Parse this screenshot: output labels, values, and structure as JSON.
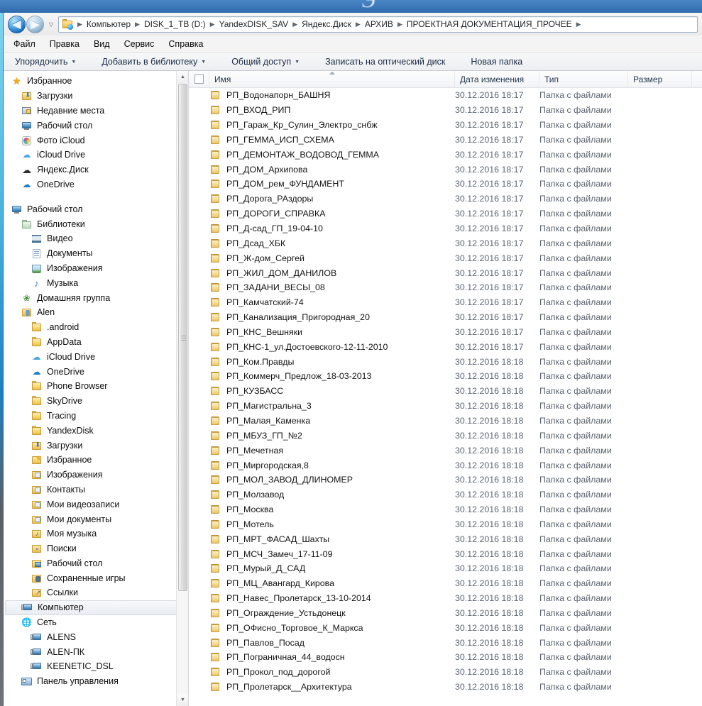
{
  "window": {
    "title_glyph": "Э"
  },
  "nav": {
    "back_label": "◀",
    "forward_label": "▶",
    "history_caret": "▽",
    "breadcrumbs": [
      "Компьютер",
      "DISK_1_TB (D:)",
      "YandexDISK_SAV",
      "Яндекс.Диск",
      "АРХИВ",
      "ПРОЕКТНАЯ ДОКУМЕНТАЦИЯ_ПРОЧЕЕ"
    ],
    "separator": "▶"
  },
  "menubar": {
    "items": [
      {
        "label": "Файл"
      },
      {
        "label": "Правка"
      },
      {
        "label": "Вид"
      },
      {
        "label": "Сервис"
      },
      {
        "label": "Справка"
      }
    ]
  },
  "commandbar": {
    "caret": "▼",
    "items": [
      {
        "label": "Упорядочить",
        "has_caret": true
      },
      {
        "label": "Добавить в библиотеку",
        "has_caret": true
      },
      {
        "label": "Общий доступ",
        "has_caret": true
      },
      {
        "label": "Записать на оптический диск",
        "has_caret": false
      },
      {
        "label": "Новая папка",
        "has_caret": false
      }
    ]
  },
  "sidebar": {
    "groups": [
      {
        "items": [
          {
            "label": "Избранное",
            "icon": "star-icon",
            "indent": 0,
            "selected": false
          },
          {
            "label": "Загрузки",
            "icon": "downloads-folder-icon",
            "indent": 1,
            "selected": false
          },
          {
            "label": "Недавние места",
            "icon": "recent-places-icon",
            "indent": 1,
            "selected": false
          },
          {
            "label": "Рабочий стол",
            "icon": "desktop-monitor-icon",
            "indent": 1,
            "selected": false
          },
          {
            "label": "Фото iCloud",
            "icon": "icloud-photos-icon",
            "indent": 1,
            "selected": false
          },
          {
            "label": "iCloud Drive",
            "icon": "icloud-drive-icon",
            "indent": 1,
            "selected": false
          },
          {
            "label": "Яндекс.Диск",
            "icon": "yandex-disk-icon",
            "indent": 1,
            "selected": false
          },
          {
            "label": "OneDrive",
            "icon": "onedrive-cloud-icon",
            "indent": 1,
            "selected": false
          }
        ]
      },
      {
        "items": [
          {
            "label": "Рабочий стол",
            "icon": "desktop-monitor-icon",
            "indent": 0,
            "selected": false
          },
          {
            "label": "Библиотеки",
            "icon": "libraries-icon",
            "indent": 1,
            "selected": false
          },
          {
            "label": "Видео",
            "icon": "video-library-icon",
            "indent": 2,
            "selected": false
          },
          {
            "label": "Документы",
            "icon": "documents-library-icon",
            "indent": 2,
            "selected": false
          },
          {
            "label": "Изображения",
            "icon": "pictures-library-icon",
            "indent": 2,
            "selected": false
          },
          {
            "label": "Музыка",
            "icon": "music-library-icon",
            "indent": 2,
            "selected": false
          },
          {
            "label": "Домашняя группа",
            "icon": "homegroup-icon",
            "indent": 1,
            "selected": false
          },
          {
            "label": "Alen",
            "icon": "user-folder-icon",
            "indent": 1,
            "selected": false
          },
          {
            "label": ".android",
            "icon": "folder-icon",
            "indent": 2,
            "selected": false
          },
          {
            "label": "AppData",
            "icon": "folder-icon",
            "indent": 2,
            "selected": false
          },
          {
            "label": "iCloud Drive",
            "icon": "icloud-drive-icon",
            "indent": 2,
            "selected": false
          },
          {
            "label": "OneDrive",
            "icon": "onedrive-synced-icon",
            "indent": 2,
            "selected": false
          },
          {
            "label": "Phone Browser",
            "icon": "folder-icon",
            "indent": 2,
            "selected": false
          },
          {
            "label": "SkyDrive",
            "icon": "folder-icon",
            "indent": 2,
            "selected": false
          },
          {
            "label": "Tracing",
            "icon": "folder-icon",
            "indent": 2,
            "selected": false
          },
          {
            "label": "YandexDisk",
            "icon": "folder-icon",
            "indent": 2,
            "selected": false
          },
          {
            "label": "Загрузки",
            "icon": "downloads-folder-icon",
            "indent": 2,
            "selected": false
          },
          {
            "label": "Избранное",
            "icon": "favorites-folder-icon",
            "indent": 2,
            "selected": false
          },
          {
            "label": "Изображения",
            "icon": "pictures-folder-icon",
            "indent": 2,
            "selected": false
          },
          {
            "label": "Контакты",
            "icon": "contacts-folder-icon",
            "indent": 2,
            "selected": false
          },
          {
            "label": "Мои видеозаписи",
            "icon": "my-videos-folder-icon",
            "indent": 2,
            "selected": false
          },
          {
            "label": "Мои документы",
            "icon": "my-documents-folder-icon",
            "indent": 2,
            "selected": false
          },
          {
            "label": "Моя музыка",
            "icon": "my-music-folder-icon",
            "indent": 2,
            "selected": false
          },
          {
            "label": "Поиски",
            "icon": "searches-folder-icon",
            "indent": 2,
            "selected": false
          },
          {
            "label": "Рабочий стол",
            "icon": "desktop-folder-icon",
            "indent": 2,
            "selected": false
          },
          {
            "label": "Сохраненные игры",
            "icon": "saved-games-folder-icon",
            "indent": 2,
            "selected": false
          },
          {
            "label": "Ссылки",
            "icon": "links-folder-icon",
            "indent": 2,
            "selected": false
          },
          {
            "label": "Компьютер",
            "icon": "computer-icon",
            "indent": 1,
            "selected": true
          },
          {
            "label": "Сеть",
            "icon": "network-icon",
            "indent": 1,
            "selected": false
          },
          {
            "label": "ALENS",
            "icon": "computer-icon",
            "indent": 2,
            "selected": false
          },
          {
            "label": "ALEN-ПК",
            "icon": "computer-icon",
            "indent": 2,
            "selected": false
          },
          {
            "label": "KEENETIC_DSL",
            "icon": "computer-icon",
            "indent": 2,
            "selected": false
          },
          {
            "label": "Панель управления",
            "icon": "control-panel-icon",
            "indent": 1,
            "selected": false
          }
        ]
      }
    ],
    "scrollbar": {
      "up_arrow": "▲",
      "down_arrow": "▼"
    }
  },
  "filelist": {
    "columns": [
      {
        "key": "name",
        "label": "Имя",
        "sorted": true
      },
      {
        "key": "date",
        "label": "Дата изменения",
        "sorted": false
      },
      {
        "key": "type",
        "label": "Тип",
        "sorted": false
      },
      {
        "key": "size",
        "label": "Размер",
        "sorted": false
      }
    ],
    "rows": [
      {
        "name": "РП_Водонапорн_БАШНЯ",
        "date": "30.12.2016 18:17",
        "type": "Папка с файлами",
        "size": ""
      },
      {
        "name": "РП_ВХОД_РИП",
        "date": "30.12.2016 18:17",
        "type": "Папка с файлами",
        "size": ""
      },
      {
        "name": "РП_Гараж_Кр_Сулин_Электро_снбж",
        "date": "30.12.2016 18:17",
        "type": "Папка с файлами",
        "size": ""
      },
      {
        "name": "РП_ГЕММА_ИСП_СХЕМА",
        "date": "30.12.2016 18:17",
        "type": "Папка с файлами",
        "size": ""
      },
      {
        "name": "РП_ДЕМОНТАЖ_ВОДОВОД_ГЕММА",
        "date": "30.12.2016 18:17",
        "type": "Папка с файлами",
        "size": ""
      },
      {
        "name": "РП_ДОМ_Архипова",
        "date": "30.12.2016 18:17",
        "type": "Папка с файлами",
        "size": ""
      },
      {
        "name": "РП_ДОМ_рем_ФУНДАМЕНТ",
        "date": "30.12.2016 18:17",
        "type": "Папка с файлами",
        "size": ""
      },
      {
        "name": "РП_Дорога_РАздоры",
        "date": "30.12.2016 18:17",
        "type": "Папка с файлами",
        "size": ""
      },
      {
        "name": "РП_ДОРОГИ_СПРАВКА",
        "date": "30.12.2016 18:17",
        "type": "Папка с файлами",
        "size": ""
      },
      {
        "name": "РП_Д-сад_ГП_19-04-10",
        "date": "30.12.2016 18:17",
        "type": "Папка с файлами",
        "size": ""
      },
      {
        "name": "РП_Дсад_ХБК",
        "date": "30.12.2016 18:17",
        "type": "Папка с файлами",
        "size": ""
      },
      {
        "name": "РП_Ж-дом_Сергей",
        "date": "30.12.2016 18:17",
        "type": "Папка с файлами",
        "size": ""
      },
      {
        "name": "РП_ЖИЛ_ДОМ_ДАНИЛОВ",
        "date": "30.12.2016 18:17",
        "type": "Папка с файлами",
        "size": ""
      },
      {
        "name": "РП_ЗАДАНИ_ВЕСЫ_08",
        "date": "30.12.2016 18:17",
        "type": "Папка с файлами",
        "size": ""
      },
      {
        "name": "РП_Камчатский-74",
        "date": "30.12.2016 18:17",
        "type": "Папка с файлами",
        "size": ""
      },
      {
        "name": "РП_Канализация_Пригородная_20",
        "date": "30.12.2016 18:17",
        "type": "Папка с файлами",
        "size": ""
      },
      {
        "name": "РП_КНС_Вешняки",
        "date": "30.12.2016 18:17",
        "type": "Папка с файлами",
        "size": ""
      },
      {
        "name": "РП_КНС-1_ул.Достоевского-12-11-2010",
        "date": "30.12.2016 18:17",
        "type": "Папка с файлами",
        "size": ""
      },
      {
        "name": "РП_Ком.Правды",
        "date": "30.12.2016 18:18",
        "type": "Папка с файлами",
        "size": ""
      },
      {
        "name": "РП_Коммерч_Предлож_18-03-2013",
        "date": "30.12.2016 18:18",
        "type": "Папка с файлами",
        "size": ""
      },
      {
        "name": "РП_КУЗБАСС",
        "date": "30.12.2016 18:18",
        "type": "Папка с файлами",
        "size": ""
      },
      {
        "name": "РП_Магистральна_3",
        "date": "30.12.2016 18:18",
        "type": "Папка с файлами",
        "size": ""
      },
      {
        "name": "РП_Малая_Каменка",
        "date": "30.12.2016 18:18",
        "type": "Папка с файлами",
        "size": ""
      },
      {
        "name": "РП_МБУЗ_ГП_№2",
        "date": "30.12.2016 18:18",
        "type": "Папка с файлами",
        "size": ""
      },
      {
        "name": "РП_Мечетная",
        "date": "30.12.2016 18:18",
        "type": "Папка с файлами",
        "size": ""
      },
      {
        "name": "РП_Миргородская,8",
        "date": "30.12.2016 18:18",
        "type": "Папка с файлами",
        "size": ""
      },
      {
        "name": "РП_МОЛ_ЗАВОД_ДЛИНОМЕР",
        "date": "30.12.2016 18:18",
        "type": "Папка с файлами",
        "size": ""
      },
      {
        "name": "РП_Молзавод",
        "date": "30.12.2016 18:18",
        "type": "Папка с файлами",
        "size": ""
      },
      {
        "name": "РП_Москва",
        "date": "30.12.2016 18:18",
        "type": "Папка с файлами",
        "size": ""
      },
      {
        "name": "РП_Мотель",
        "date": "30.12.2016 18:18",
        "type": "Папка с файлами",
        "size": ""
      },
      {
        "name": "РП_МРТ_ФАСАД_Шахты",
        "date": "30.12.2016 18:18",
        "type": "Папка с файлами",
        "size": ""
      },
      {
        "name": "РП_МСЧ_Замеч_17-11-09",
        "date": "30.12.2016 18:18",
        "type": "Папка с файлами",
        "size": ""
      },
      {
        "name": "РП_Мурый_Д_САД",
        "date": "30.12.2016 18:18",
        "type": "Папка с файлами",
        "size": ""
      },
      {
        "name": "РП_МЦ_Авангард_Кирова",
        "date": "30.12.2016 18:18",
        "type": "Папка с файлами",
        "size": ""
      },
      {
        "name": "РП_Навес_Пролетарск_13-10-2014",
        "date": "30.12.2016 18:18",
        "type": "Папка с файлами",
        "size": ""
      },
      {
        "name": "РП_Ограждение_Устьдонецк",
        "date": "30.12.2016 18:18",
        "type": "Папка с файлами",
        "size": ""
      },
      {
        "name": "РП_ОФисно_Торговое_К_Маркса",
        "date": "30.12.2016 18:18",
        "type": "Папка с файлами",
        "size": ""
      },
      {
        "name": "РП_Павлов_Посад",
        "date": "30.12.2016 18:18",
        "type": "Папка с файлами",
        "size": ""
      },
      {
        "name": "РП_Пограничная_44_водосн",
        "date": "30.12.2016 18:18",
        "type": "Папка с файлами",
        "size": ""
      },
      {
        "name": "РП_Прокол_под_дорогой",
        "date": "30.12.2016 18:18",
        "type": "Папка с файлами",
        "size": ""
      },
      {
        "name": "РП_Пролетарск__Архитектура",
        "date": "30.12.2016 18:18",
        "type": "Папка с файлами",
        "size": ""
      }
    ]
  }
}
